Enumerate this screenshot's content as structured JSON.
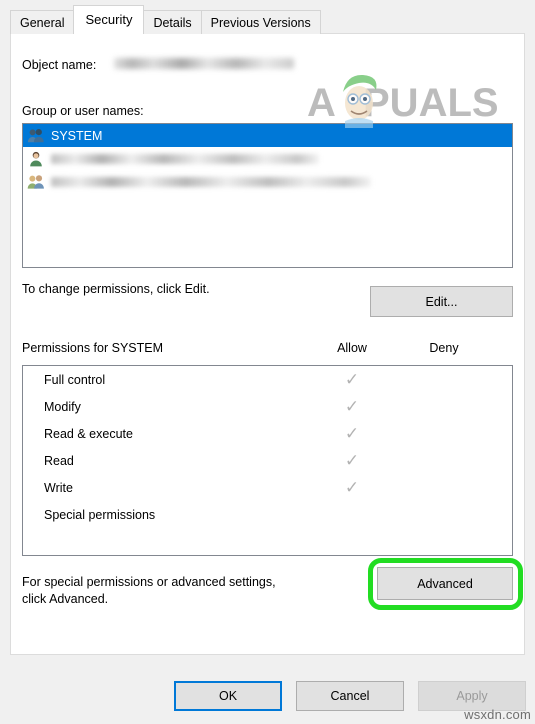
{
  "dialog": {
    "tabs": [
      {
        "label": "General",
        "active": false
      },
      {
        "label": "Security",
        "active": true
      },
      {
        "label": "Details",
        "active": false
      },
      {
        "label": "Previous Versions",
        "active": false
      }
    ],
    "object_name_label": "Object name:",
    "object_name_value": "",
    "group_user_label": "Group or user names:",
    "users": [
      {
        "name": "SYSTEM",
        "icon": "group-icon",
        "selected": true,
        "redacted": false
      },
      {
        "name": "",
        "icon": "user-icon",
        "selected": false,
        "redacted": true
      },
      {
        "name": "",
        "icon": "group-icon",
        "selected": false,
        "redacted": true
      }
    ],
    "change_permissions_text": "To change permissions, click Edit.",
    "edit_button": "Edit...",
    "permissions_for_label": "Permissions for SYSTEM",
    "column_allow": "Allow",
    "column_deny": "Deny",
    "permissions": [
      {
        "name": "Full control",
        "allow": true,
        "deny": false
      },
      {
        "name": "Modify",
        "allow": true,
        "deny": false
      },
      {
        "name": "Read & execute",
        "allow": true,
        "deny": false
      },
      {
        "name": "Read",
        "allow": true,
        "deny": false
      },
      {
        "name": "Write",
        "allow": true,
        "deny": false
      },
      {
        "name": "Special permissions",
        "allow": false,
        "deny": false
      }
    ],
    "advanced_text_line1": "For special permissions or advanced settings,",
    "advanced_text_line2": "click Advanced.",
    "advanced_button": "Advanced",
    "footer": {
      "ok": "OK",
      "cancel": "Cancel",
      "apply": "Apply",
      "apply_disabled": true
    }
  },
  "annotations": {
    "highlight_target": "advanced-button",
    "highlight_color": "#22dd22"
  },
  "watermarks": {
    "brand": "APPUALS",
    "site": "wsxdn.com"
  },
  "colors": {
    "selection_blue": "#0078d7",
    "dialog_gray": "#f0f0f0",
    "button_face": "#e1e1e1",
    "check_gray": "#b3b3b3",
    "highlight_green": "#22dd22"
  }
}
